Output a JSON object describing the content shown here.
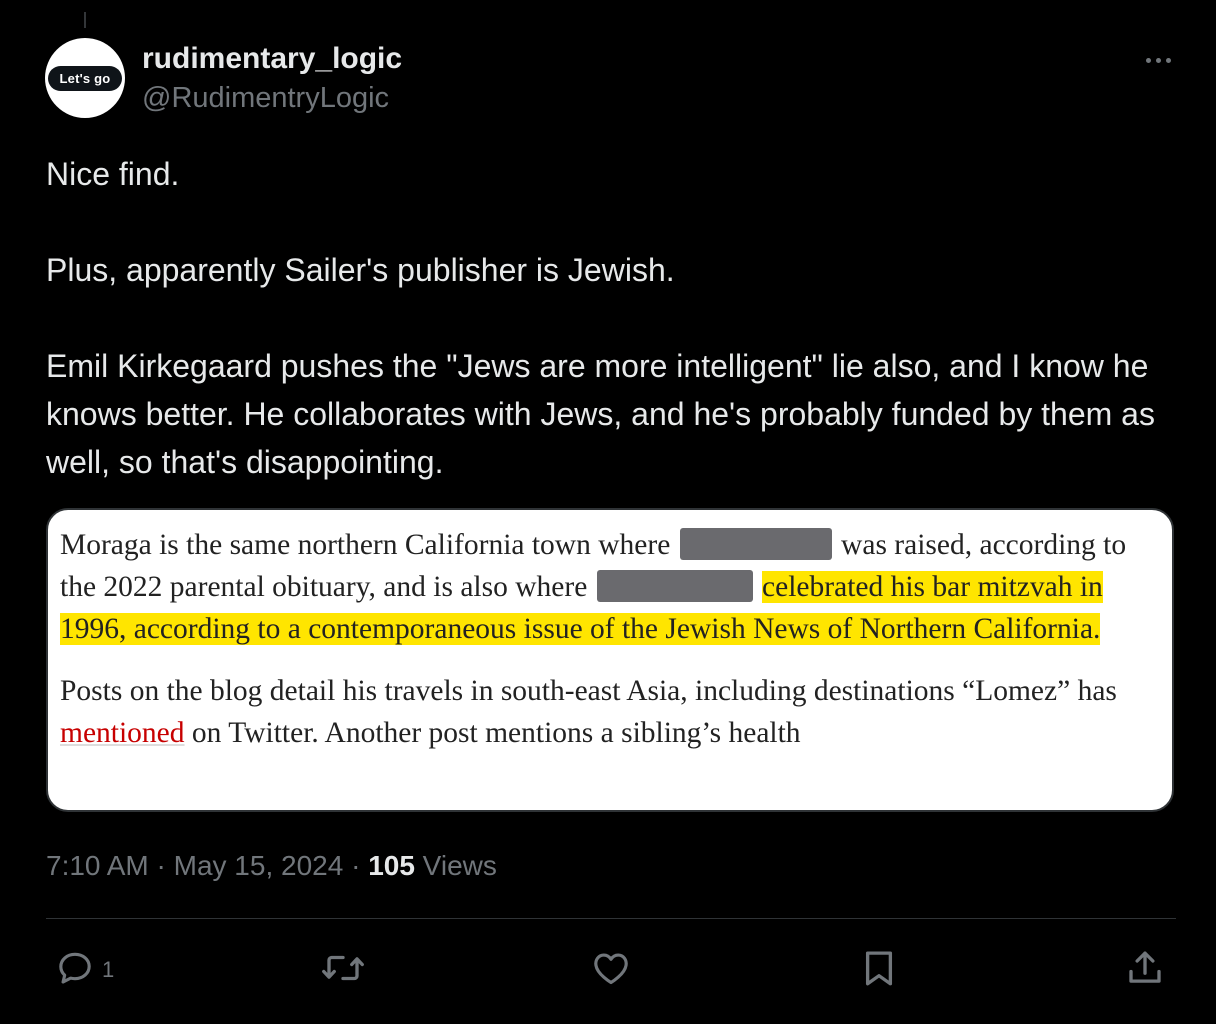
{
  "author": {
    "avatar_text": "Let's go",
    "display_name": "rudimentary_logic",
    "handle": "@RudimentryLogic"
  },
  "tweet": {
    "paragraphs": [
      "Nice find.",
      "Plus, apparently Sailer's publisher is Jewish.",
      "Emil Kirkegaard pushes the \"Jews are more intelligent\" lie also, and I know he knows better. He collaborates with Jews, and he's probably funded by them as well, so that's disappointing."
    ]
  },
  "media": {
    "p1_part1": "Moraga is the same northern California town where",
    "p1_part2": "was raised, according to the 2022 parental obituary, and is also where",
    "p1_highlight": "celebrated his bar mitzvah in 1996, according to a contemporaneous issue of the Jewish News of Northern California.",
    "p2_part1": "Posts on the blog detail his travels in south-east Asia, including destinations “Lomez” has",
    "p2_link": "mentioned",
    "p2_part2": "on Twitter. Another post mentions a sibling’s health"
  },
  "meta": {
    "time": "7:10 AM",
    "sep1": " · ",
    "date": "May 15, 2024",
    "sep2": " · ",
    "views_count": "105",
    "views_label": " Views"
  },
  "actions": {
    "reply_count": "1"
  },
  "icons": [
    "more-icon",
    "reply-icon",
    "retweet-icon",
    "like-icon",
    "bookmark-icon",
    "share-icon"
  ],
  "colors": {
    "background": "#000000",
    "primary_text": "#e7e9ea",
    "secondary_text": "#71767b",
    "highlight": "#ffe500",
    "link": "#c70000"
  }
}
